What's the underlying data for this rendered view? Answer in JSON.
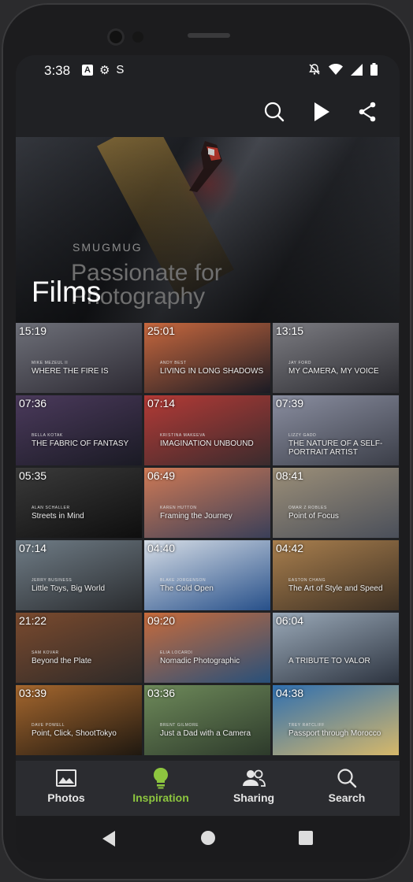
{
  "status": {
    "time": "3:38",
    "left_icons": [
      "A",
      "⚙",
      "S"
    ],
    "right_icons": [
      "bell-off-icon",
      "wifi-icon",
      "signal-icon",
      "battery-icon"
    ]
  },
  "hero": {
    "brand": "SMUGMUG",
    "tagline": "Passionate for Photography",
    "title": "Films"
  },
  "tiles": [
    {
      "duration": "15:19",
      "author": "MIKE MEZEUL II",
      "title": "WHERE THE FIRE IS",
      "bg": "#6e7079",
      "bg2": "#2d2a33"
    },
    {
      "duration": "25:01",
      "author": "ANDY BEST",
      "title": "LIVING IN LONG SHADOWS",
      "bg": "#c8683e",
      "bg2": "#1b1b24"
    },
    {
      "duration": "13:15",
      "author": "JAY FORD",
      "title": "MY CAMERA, MY VOICE",
      "bg": "#7c7c82",
      "bg2": "#2b2b30"
    },
    {
      "duration": "07:36",
      "author": "BELLA KOTAK",
      "title": "THE FABRIC OF FANTASY",
      "bg": "#4b3a5c",
      "bg2": "#1a1a24"
    },
    {
      "duration": "07:14",
      "author": "KRISTINA MAKEEVA",
      "title": "IMAGINATION UNBOUND",
      "bg": "#b43a36",
      "bg2": "#3a2b2d"
    },
    {
      "duration": "07:39",
      "author": "LIZZY GADD",
      "title": "THE NATURE OF A SELF-PORTRAIT ARTIST",
      "bg": "#8a8ea0",
      "bg2": "#3b3e48"
    },
    {
      "duration": "05:35",
      "author": "ALAN SCHALLER",
      "title": "Streets in Mind",
      "bg": "#3a3a3a",
      "bg2": "#0e0e0e"
    },
    {
      "duration": "06:49",
      "author": "KAREN HUTTON",
      "title": "Framing the Journey",
      "bg": "#d07a55",
      "bg2": "#3a3f58"
    },
    {
      "duration": "08:41",
      "author": "OMAR Z ROBLES",
      "title": "Point of Focus",
      "bg": "#9c8f78",
      "bg2": "#4a4f5a"
    },
    {
      "duration": "07:14",
      "author": "JERRY BUSINESS",
      "title": "Little Toys, Big World",
      "bg": "#6f7c86",
      "bg2": "#2a2c2f"
    },
    {
      "duration": "04:40",
      "author": "BLAKE JORGENSON",
      "title": "The Cold Open",
      "bg": "#d6dde6",
      "bg2": "#27508a"
    },
    {
      "duration": "04:42",
      "author": "EASTON CHANG",
      "title": "The Art of Style and Speed",
      "bg": "#a97f4e",
      "bg2": "#3d3023"
    },
    {
      "duration": "21:22",
      "author": "SAM KOVAR",
      "title": "Beyond the Plate",
      "bg": "#7a4a2e",
      "bg2": "#2f2a28"
    },
    {
      "duration": "09:20",
      "author": "ELIA LOCARDI",
      "title": "Nomadic Photographic",
      "bg": "#c86b3b",
      "bg2": "#28507a"
    },
    {
      "duration": "06:04",
      "author": "",
      "title": "A TRIBUTE TO VALOR",
      "bg": "#9aa9b8",
      "bg2": "#2d3440"
    },
    {
      "duration": "03:39",
      "author": "DAVE POWELL",
      "title": "Point, Click, ShootTokyo",
      "bg": "#a5672e",
      "bg2": "#1f1810"
    },
    {
      "duration": "03:36",
      "author": "BRENT GILMORE",
      "title": "Just a Dad with a Camera",
      "bg": "#6e8a5a",
      "bg2": "#2d3a2b"
    },
    {
      "duration": "04:38",
      "author": "TREY RATCLIFF",
      "title": "Passport through Morocco",
      "bg": "#2f6fb0",
      "bg2": "#d6b86a"
    }
  ],
  "nav": [
    {
      "label": "Photos",
      "icon": "image-icon",
      "color": "#e6e6e6"
    },
    {
      "label": "Inspiration",
      "icon": "lightbulb-icon",
      "color": "#8dc63f"
    },
    {
      "label": "Sharing",
      "icon": "people-icon",
      "color": "#e6e6e6"
    },
    {
      "label": "Search",
      "icon": "search-icon",
      "color": "#e6e6e6"
    }
  ],
  "accent": "#8dc63f"
}
